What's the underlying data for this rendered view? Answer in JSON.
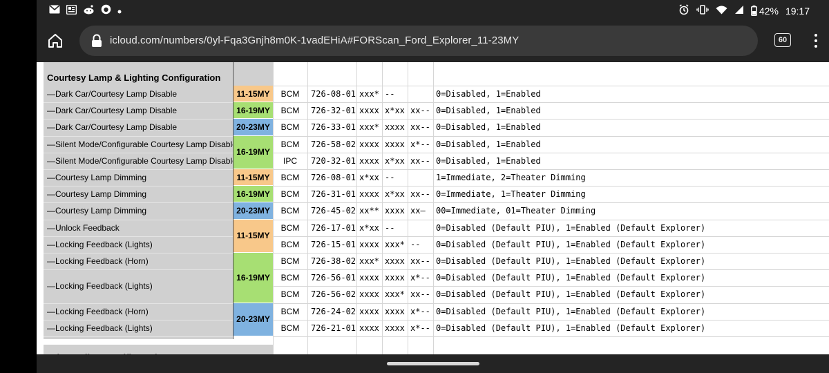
{
  "statusbar": {
    "left_icons": [
      "gmail-icon",
      "news-icon",
      "reddit-icon",
      "firefox-icon",
      "dot-icon"
    ],
    "battery": "42%",
    "time": "19:17"
  },
  "browser": {
    "url": "icloud.com/numbers/0yl-Fqa3Gnjh8m0K-1vadEHiA#FORScan_Ford_Explorer_11-23MY",
    "tab_count": "60"
  },
  "sheet": {
    "section_title": "Courtesy Lamp & Lighting Configuration",
    "next_section_title": "Other Police-specific settings",
    "rows": [
      {
        "label": "—Dark Car/Courtesy Lamp Disable",
        "module": "BCM",
        "address": "726-08-01",
        "c1": "xxx*",
        "c2": "--",
        "c3": "",
        "desc": "0=Disabled, 1=Enabled"
      },
      {
        "label": "—Dark Car/Courtesy Lamp Disable",
        "module": "BCM",
        "address": "726-32-01",
        "c1": "xxxx",
        "c2": "x*xx",
        "c3": "xx--",
        "desc": "0=Disabled, 1=Enabled"
      },
      {
        "label": "—Dark Car/Courtesy Lamp Disable",
        "module": "BCM",
        "address": "726-33-01",
        "c1": "xxx*",
        "c2": "xxxx",
        "c3": "xx--",
        "desc": "0=Disabled, 1=Enabled"
      },
      {
        "label": "—Silent Mode/Configurable Courtesy Lamp Disable",
        "module": "BCM",
        "address": "726-58-02",
        "c1": "xxxx",
        "c2": "xxxx",
        "c3": "x*--",
        "desc": "0=Disabled, 1=Enabled"
      },
      {
        "label": "—Silent Mode/Configurable Courtesy Lamp Disable",
        "module": "IPC",
        "address": "720-32-01",
        "c1": "xxxx",
        "c2": "x*xx",
        "c3": "xx--",
        "desc": "0=Disabled, 1=Enabled"
      },
      {
        "label": "—Courtesy Lamp Dimming",
        "module": "BCM",
        "address": "726-08-01",
        "c1": "x*xx",
        "c2": "--",
        "c3": "",
        "desc": "1=Immediate, 2=Theater Dimming"
      },
      {
        "label": "—Courtesy Lamp Dimming",
        "module": "BCM",
        "address": "726-31-01",
        "c1": "xxxx",
        "c2": "x*xx",
        "c3": "xx--",
        "desc": "0=Immediate, 1=Theater Dimming"
      },
      {
        "label": "—Courtesy Lamp Dimming",
        "module": "BCM",
        "address": "726-45-02",
        "c1": "xx**",
        "c2": "xxxx",
        "c3": "xx–",
        "desc": "00=Immediate, 01=Theater Dimming"
      },
      {
        "label": "—Unlock Feedback",
        "module": "BCM",
        "address": "726-17-01",
        "c1": "x*xx",
        "c2": "--",
        "c3": "",
        "desc": "0=Disabled (Default PIU), 1=Enabled (Default Explorer)"
      },
      {
        "label": "—Locking Feedback (Lights)",
        "module": "BCM",
        "address": "726-15-01",
        "c1": "xxxx",
        "c2": "xxx*",
        "c3": "--",
        "desc": "0=Disabled (Default PIU), 1=Enabled (Default Explorer)"
      },
      {
        "label": "—Locking Feedback (Horn)",
        "module": "BCM",
        "address": "726-38-02",
        "c1": "xxx*",
        "c2": "xxxx",
        "c3": "xx--",
        "desc": "0=Disabled (Default PIU), 1=Enabled (Default Explorer)"
      },
      {
        "label": "",
        "module": "BCM",
        "address": "726-56-01",
        "c1": "xxxx",
        "c2": "xxxx",
        "c3": "x*--",
        "desc": "0=Disabled (Default PIU), 1=Enabled (Default Explorer)"
      },
      {
        "label": "",
        "module": "BCM",
        "address": "726-56-02",
        "c1": "xxxx",
        "c2": "xxx*",
        "c3": "xx--",
        "desc": "0=Disabled (Default PIU), 1=Enabled (Default Explorer)"
      },
      {
        "label": "—Locking Feedback (Horn)",
        "module": "BCM",
        "address": "726-24-02",
        "c1": "xxxx",
        "c2": "xxxx",
        "c3": "x*--",
        "desc": "0=Disabled (Default PIU), 1=Enabled (Default Explorer)"
      },
      {
        "label": "—Locking Feedback (Lights)",
        "module": "BCM",
        "address": "726-21-01",
        "c1": "xxxx",
        "c2": "xxxx",
        "c3": "x*--",
        "desc": "0=Disabled (Default PIU), 1=Enabled (Default Explorer)"
      }
    ],
    "merged_label": {
      "text": "—Locking Feedback (Lights)",
      "first_row": 11,
      "span": 2
    },
    "year_badges": [
      {
        "text": "11-15MY",
        "color": "#f8c88a",
        "first_row": 0,
        "span": 1
      },
      {
        "text": "16-19MY",
        "color": "#a7df73",
        "first_row": 1,
        "span": 1
      },
      {
        "text": "20-23MY",
        "color": "#7fb2e0",
        "first_row": 2,
        "span": 1
      },
      {
        "text": "16-19MY",
        "color": "#a7df73",
        "first_row": 3,
        "span": 2
      },
      {
        "text": "11-15MY",
        "color": "#f8c88a",
        "first_row": 5,
        "span": 1
      },
      {
        "text": "16-19MY",
        "color": "#a7df73",
        "first_row": 6,
        "span": 1
      },
      {
        "text": "20-23MY",
        "color": "#7fb2e0",
        "first_row": 7,
        "span": 1
      },
      {
        "text": "11-15MY",
        "color": "#f8c88a",
        "first_row": 8,
        "span": 2
      },
      {
        "text": "16-19MY",
        "color": "#a7df73",
        "first_row": 10,
        "span": 3
      },
      {
        "text": "20-23MY",
        "color": "#7fb2e0",
        "first_row": 13,
        "span": 2
      }
    ]
  }
}
